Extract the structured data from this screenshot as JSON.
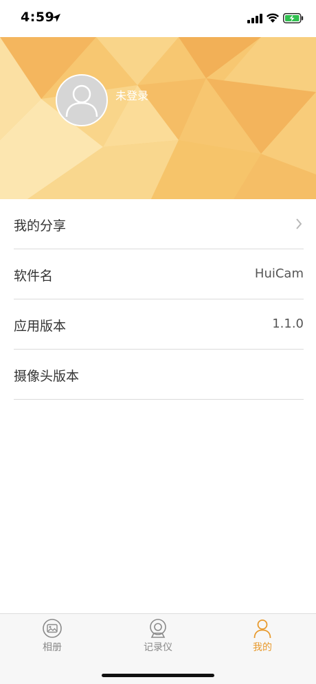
{
  "status_bar": {
    "time": "4:59"
  },
  "header": {
    "login_status": "未登录"
  },
  "menu": [
    {
      "label": "我的分享",
      "value": ""
    },
    {
      "label": "软件名",
      "value": "HuiCam"
    },
    {
      "label": "应用版本",
      "value": "1.1.0"
    },
    {
      "label": "摄像头版本",
      "value": ""
    }
  ],
  "tabbar": {
    "tabs": [
      {
        "label": "相册",
        "icon": "photo-album-icon"
      },
      {
        "label": "记录仪",
        "icon": "camera-icon"
      },
      {
        "label": "我的",
        "icon": "profile-icon",
        "active": true
      }
    ]
  },
  "colors": {
    "accent": "#e89a2d",
    "header": "#f6c46a"
  }
}
